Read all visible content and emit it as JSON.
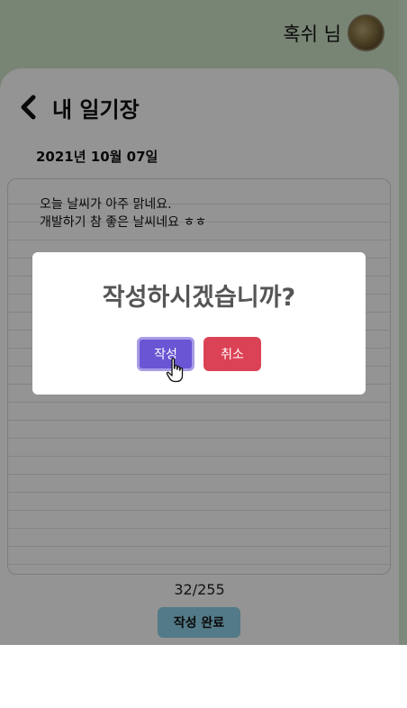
{
  "header": {
    "user_name": "혹쉬 님"
  },
  "page": {
    "title": "내 일기장",
    "date": "2021년 10월 07일"
  },
  "diary": {
    "lines": [
      "오늘 날씨가 아주 맑네요.",
      "개발하기 참 좋은 날씨네요 ㅎㅎ"
    ],
    "counter": "32/255",
    "complete_label": "작성 완료"
  },
  "modal": {
    "title": "작성하시겠습니까?",
    "confirm_label": "작성",
    "cancel_label": "취소"
  },
  "colors": {
    "confirm": "#6a55d4",
    "cancel": "#dc4255",
    "complete": "#8fd3ea",
    "background": "#cfe3c9"
  }
}
